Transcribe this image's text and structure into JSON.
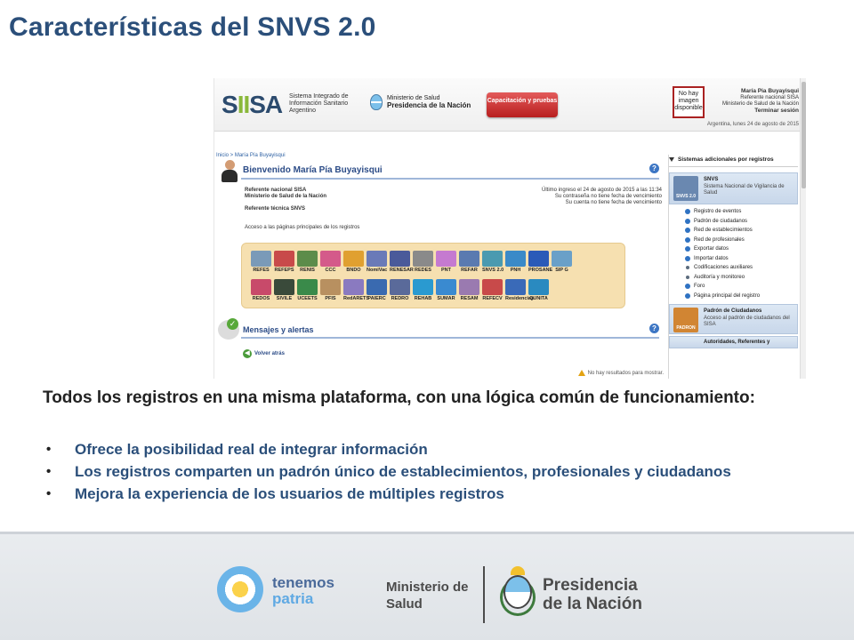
{
  "slide": {
    "title": "Características del SNVS 2.0",
    "lead": "Todos los registros en una misma plataforma, con una lógica común de funcionamiento:",
    "bullets": [
      "Ofrece la posibilidad real de integrar información",
      "Los registros comparten un padrón único de establecimientos, profesionales y ciudadanos",
      "Mejora la experiencia de los usuarios de múltiples registros"
    ]
  },
  "screenshot": {
    "header": {
      "logo": "SIISA",
      "logo_sub": "Sistema Integrado de Información Sanitario Argentino",
      "ministry_line1": "Ministerio de Salud",
      "ministry_line2": "Presidencia de la Nación",
      "training_button": "Capacitación y pruebas",
      "no_image": "No hay imagen disponible",
      "user_name": "María Pia Buyayisqui",
      "user_role1": "Referente nacional SISA",
      "user_role2": "Ministerio de Salud de la Nación",
      "logout": "Terminar sesión",
      "date": "Argentina, lunes 24 de agosto de 2015"
    },
    "breadcrumb": "Inicio > María Pía Buyayisqui",
    "welcome": "Bienvenido María Pía Buyayisqui",
    "ref_line1": "Referente nacional SISA",
    "ref_line2": "Ministerio de Salud de la Nación",
    "ref_line3": "Referente técnica SNVS",
    "last_login1": "Último ingreso el 24 de agosto de 2015 a las 11:34",
    "last_login2": "Su contraseña no tiene fecha de vencimiento",
    "last_login3": "Su cuenta no tiene fecha de vencimiento",
    "access_text": "Acceso a las páginas principales de los registros",
    "registries_row1": [
      {
        "label": "REFES",
        "color": "#7a9ab8"
      },
      {
        "label": "REFEPS",
        "color": "#c84a4a"
      },
      {
        "label": "RENIS",
        "color": "#5c8c4a"
      },
      {
        "label": "CCC",
        "color": "#d45a8a"
      },
      {
        "label": "BNDO",
        "color": "#e0a030"
      },
      {
        "label": "NomiVac",
        "color": "#6a7ab8"
      },
      {
        "label": "RENESAR",
        "color": "#4a5a9a"
      },
      {
        "label": "REDES",
        "color": "#8a8a8a"
      },
      {
        "label": "PNT",
        "color": "#c57ad0"
      },
      {
        "label": "REFAR",
        "color": "#5a7ab0"
      },
      {
        "label": "SNVS 2.0",
        "color": "#4a9ab0"
      },
      {
        "label": "PNH",
        "color": "#3a8ac8"
      },
      {
        "label": "PROSANE",
        "color": "#2a5ab8"
      },
      {
        "label": "SIP G",
        "color": "#6aa0c8"
      }
    ],
    "registries_row2": [
      {
        "label": "REDOS",
        "color": "#c84a6a"
      },
      {
        "label": "SIVILE",
        "color": "#3a4a3a"
      },
      {
        "label": "UCEETS",
        "color": "#3a8a4a"
      },
      {
        "label": "PFIS",
        "color": "#b89060"
      },
      {
        "label": "RedARETS",
        "color": "#8a7ac0"
      },
      {
        "label": "PAIERC",
        "color": "#3a6ab0"
      },
      {
        "label": "REDRO",
        "color": "#5a6a9a"
      },
      {
        "label": "REHAB",
        "color": "#2a9ad0"
      },
      {
        "label": "SUMAR",
        "color": "#3a8ad0"
      },
      {
        "label": "RESAM",
        "color": "#9a7ab0"
      },
      {
        "label": "REFECV",
        "color": "#c84a4a"
      },
      {
        "label": "Residencias",
        "color": "#3a6ab8"
      },
      {
        "label": "QUNITA",
        "color": "#2a8ac0"
      }
    ],
    "messages_title": "Mensajes y alertas",
    "back_label": "Volver atrás",
    "no_results": "No hay resultados para mostrar.",
    "sidebar": {
      "title": "Sistemas adicionales por registros",
      "snvs_name": "SNVS",
      "snvs_desc": "Sistema Nacional de Vigilancia de Salud",
      "snvs_badge": "SNVS 2.0",
      "items": [
        "Registro de eventos",
        "Padrón de ciudadanos",
        "Red de establecimientos",
        "Red de profesionales",
        "Exportar datos",
        "Importar datos",
        "Codificaciones auxiliares",
        "Auditoría y monitoreo",
        "Foro",
        "Página principal del registro"
      ],
      "padron_name": "Padrón de Ciudadanos",
      "padron_desc": "Acceso al padrón de ciudadanos del SISA",
      "padron_badge": "PADRON",
      "autoridades": "Autoridades, Referentes y"
    }
  },
  "footer": {
    "tp_line1": "tenemos",
    "tp_line2": "patria",
    "ms_line1": "Ministerio de",
    "ms_line2": "Salud",
    "pres_line1": "Presidencia",
    "pres_line2": "de la Nación"
  }
}
